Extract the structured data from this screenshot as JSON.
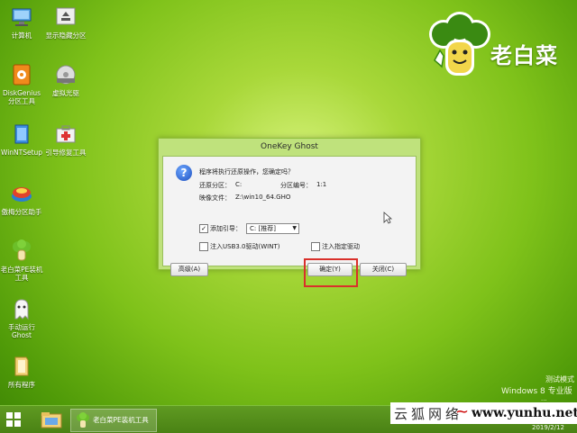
{
  "desktop": {
    "icons": [
      {
        "label": "计算机"
      },
      {
        "label": "显示隐藏分区"
      },
      {
        "label": "DiskGenius\n分区工具"
      },
      {
        "label": "虚拟光驱"
      },
      {
        "label": "WinNTSetup"
      },
      {
        "label": "引导修复工具"
      },
      {
        "label": "傲梅分区助手"
      },
      {
        "label": "老白菜PE装机\n工具"
      },
      {
        "label": "手动运行\nGhost"
      },
      {
        "label": "所有程序"
      }
    ]
  },
  "logo": {
    "text": "老白菜"
  },
  "dialog": {
    "title": "OneKey Ghost",
    "message": "程序将执行还原操作，您确定吗？",
    "restore_partition_label": "还原分区：",
    "restore_partition_value": "C:",
    "partition_number_label": "分区编号：",
    "partition_number_value": "1:1",
    "image_file_label": "映像文件：",
    "image_file_value": "Z:\\win10_64.GHO",
    "add_boot_label": "添加引导：",
    "add_boot_checked": "✓",
    "boot_select_value": "C: [推荐]",
    "inject_usb_label": "注入USB3.0驱动(WINT)",
    "inject_driver_label": "注入指定驱动",
    "advanced_button": "高级(A)",
    "confirm_button": "确定(Y)",
    "close_button": "关闭(C)"
  },
  "taskbar": {
    "app_label": "老白菜PE装机工具"
  },
  "watermark": {
    "mode": "测试模式",
    "os": "Windows 8 专业版",
    "build": "..."
  },
  "site_banner": {
    "cn": "云狐网络",
    "tilde": "~",
    "en": "www.yunhu.net"
  },
  "clock": {
    "date": "2019/2/12"
  },
  "colors": {
    "accent_red": "#d9302b",
    "desktop_green": "#7fc21a"
  }
}
